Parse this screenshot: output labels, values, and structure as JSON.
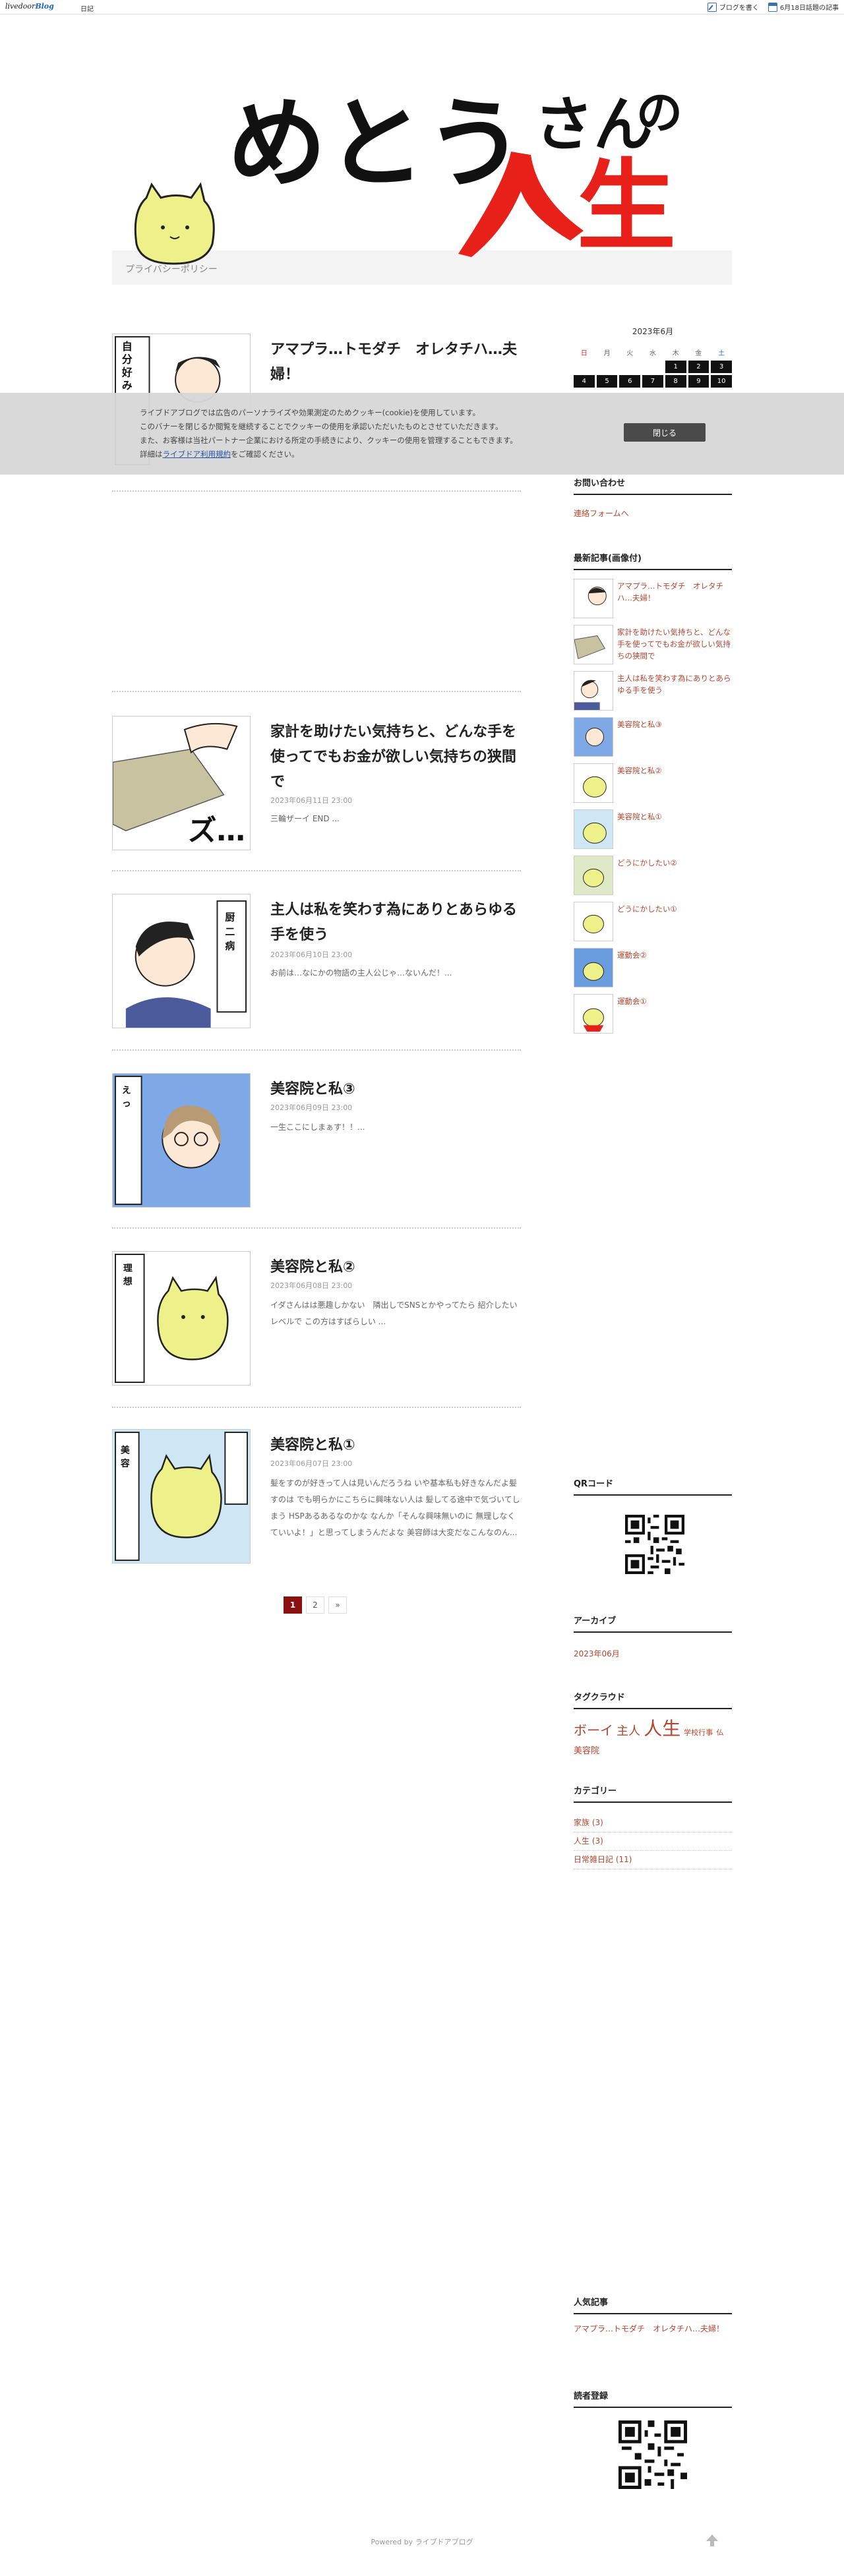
{
  "topbar": {
    "logo_prefix": "livedoor",
    "logo_suffix": "Blog",
    "diary": "日記",
    "write_label": "ブログを書く",
    "topic_label": "6月18日話題の記事"
  },
  "header": {
    "privacy_label": "プライバシーポリシー"
  },
  "calendar": {
    "title": "2023年6月",
    "weekdays": [
      "日",
      "月",
      "火",
      "水",
      "木",
      "金",
      "土"
    ],
    "row1": [
      "",
      "",
      "",
      "",
      "1",
      "2",
      "3"
    ],
    "row2": [
      "4",
      "5",
      "6",
      "7",
      "8",
      "9",
      "10"
    ]
  },
  "cookie": {
    "line1": "ライブドアブログでは広告のパーソナライズや効果測定のためクッキー(cookie)を使用しています。",
    "line2": "このバナーを閉じるか閲覧を継続することでクッキーの使用を承認いただいたものとさせていただきます。",
    "line3": "また、お客様は当社パートナー企業における所定の手続きにより、クッキーの使用を管理することもできます。",
    "line4_prefix": "詳細は",
    "line4_link": "ライブドア利用規約",
    "line4_suffix": "をご確認ください。",
    "close_label": "閉じる"
  },
  "articles": [
    {
      "title": "アマプラ…トモダチ　オレタチハ…夫婦！",
      "date": "",
      "excerpt": ""
    },
    {
      "title": "家計を助けたい気持ちと、どんな手を使ってでもお金が欲しい気持ちの狭間で",
      "date": "2023年06月11日 23:00",
      "excerpt": "三輪ザーイ END ..."
    },
    {
      "title": "主人は私を笑わす為にありとあらゆる手を使う",
      "date": "2023年06月10日 23:00",
      "excerpt": "お前は…なにかの物語の主人公じゃ…ないんだ！..."
    },
    {
      "title": "美容院と私③",
      "date": "2023年06月09日 23:00",
      "excerpt": "一生ここにしまぁす！！..."
    },
    {
      "title": "美容院と私②",
      "date": "2023年06月08日 23:00",
      "excerpt": "イダさんはは悪趣しかない　隣出しでSNSとかやってたら 紹介したいレベルで この方はすばらしい ..."
    },
    {
      "title": "美容院と私①",
      "date": "2023年06月07日 23:00",
      "excerpt": "髪をすのが好きって人は見いんだろうね いや基本私も好きなんだよ髪すのは でも明らかにこちらに興味ない人は 髪してる途中で気づいてしまう HSPあるあるなのかな なんか「そんな興味無いのに 無理しなくていいよ！」と思ってしまうんだよな 美容師は大変だなこんなのん..."
    }
  ],
  "pager": {
    "current": "1",
    "next": "2",
    "more": "»"
  },
  "sidebar": {
    "contact_head": "お問い合わせ",
    "contact_link": "連絡フォームへ",
    "recent_head": "最新記事(画像付)",
    "recent": [
      "アマプラ…トモダチ　オレタチハ…夫婦！",
      "家計を助けたい気持ちと、どんな手を使ってでもお金が欲しい気持ちの狭間で",
      "主人は私を笑わす為にありとあらゆる手を使う",
      "美容院と私③",
      "美容院と私②",
      "美容院と私①",
      "どうにかしたい②",
      "どうにかしたい①",
      "運動会②",
      "運動会①"
    ],
    "qr_head": "QRコード",
    "archive_head": "アーカイブ",
    "archive_link": "2023年06月",
    "tag_head": "タグクラウド",
    "tags": [
      "ボーイ",
      "主人",
      "人生",
      "学校行事",
      "仏",
      "美容院"
    ],
    "category_head": "カテゴリー",
    "categories": [
      "家族 (3)",
      "人生 (3)",
      "日常雑日記 (11)"
    ],
    "popular_head": "人気記事",
    "popular_link": "アマプラ…トモダチ　オレタチハ…夫婦！",
    "reader_head": "読者登録"
  },
  "footer": {
    "text": "Powered by ライブドアブログ"
  },
  "colors": {
    "accent": "#b5442e",
    "pager_active": "#8b1111",
    "title_red": "#e8201a"
  }
}
